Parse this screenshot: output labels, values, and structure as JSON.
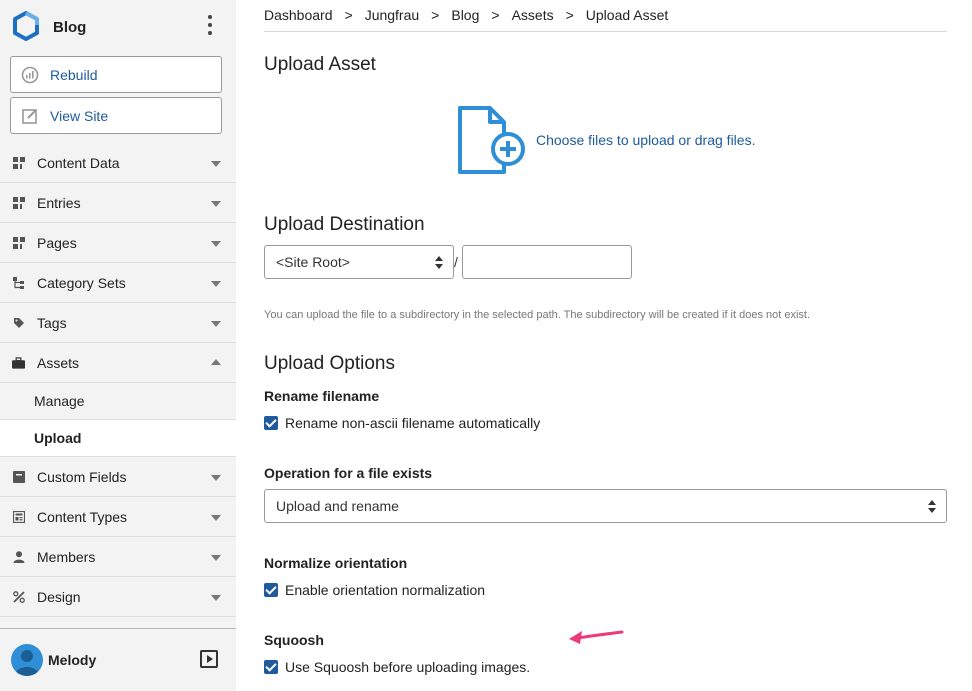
{
  "sidebar": {
    "site_name": "Blog",
    "buttons": {
      "rebuild": "Rebuild",
      "view_site": "View Site"
    },
    "menu": [
      {
        "label": "Content Data",
        "icon": "grid-icon",
        "expanded": false
      },
      {
        "label": "Entries",
        "icon": "grid-icon",
        "expanded": false
      },
      {
        "label": "Pages",
        "icon": "grid-icon",
        "expanded": false
      },
      {
        "label": "Category Sets",
        "icon": "tree-icon",
        "expanded": false
      },
      {
        "label": "Tags",
        "icon": "tag-icon",
        "expanded": false
      },
      {
        "label": "Assets",
        "icon": "briefcase-icon",
        "expanded": true
      },
      {
        "label": "Custom Fields",
        "icon": "box-icon",
        "expanded": false
      },
      {
        "label": "Content Types",
        "icon": "layout-icon",
        "expanded": false
      },
      {
        "label": "Members",
        "icon": "user-icon",
        "expanded": false
      },
      {
        "label": "Design",
        "icon": "tools-icon",
        "expanded": false
      }
    ],
    "assets_submenu": [
      {
        "label": "Manage",
        "active": false
      },
      {
        "label": "Upload",
        "active": true
      }
    ],
    "user": {
      "name": "Melody"
    }
  },
  "breadcrumb": [
    "Dashboard",
    "Jungfrau",
    "Blog",
    "Assets",
    "Upload Asset"
  ],
  "breadcrumb_separator": ">",
  "upload": {
    "title": "Upload Asset",
    "dropzone_text": "Choose files to upload or drag files."
  },
  "destination": {
    "title": "Upload Destination",
    "selected": "<Site Root>",
    "separator": "/",
    "subdirectory_value": "",
    "hint": "You can upload the file to a subdirectory in the selected path. The subdirectory will be created if it does not exist."
  },
  "options": {
    "title": "Upload Options",
    "rename": {
      "label": "Rename filename",
      "checkbox": "Rename non-ascii filename automatically",
      "checked": true
    },
    "operation": {
      "label": "Operation for a file exists",
      "selected": "Upload and rename"
    },
    "normalize": {
      "label": "Normalize orientation",
      "checkbox": "Enable orientation normalization",
      "checked": true
    },
    "squoosh": {
      "label": "Squoosh",
      "checkbox": "Use Squoosh before uploading images.",
      "checked": true
    }
  },
  "colors": {
    "accent": "#1e5a9c",
    "sidebar_bg": "#f3f3f3",
    "upload_icon": "#2e8fd6",
    "annotation_arrow": "#ee3a7a"
  }
}
